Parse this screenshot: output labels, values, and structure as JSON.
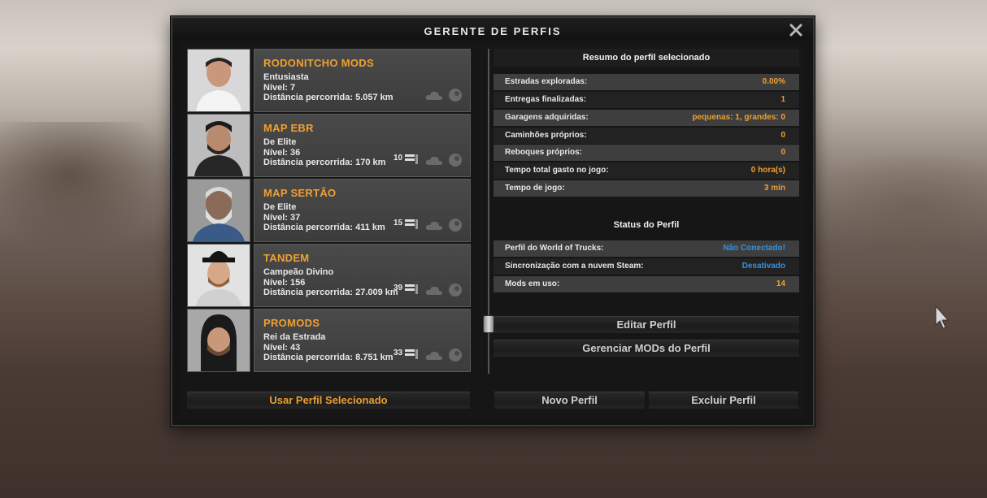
{
  "window": {
    "title": "GERENTE DE PERFIS"
  },
  "profiles": [
    {
      "name": "RODONITCHO MODS",
      "rank": "Entusiasta",
      "level": "Nível: 7",
      "distance": "Distância percorrida: 5.057 km",
      "mods": ""
    },
    {
      "name": "MAP EBR",
      "rank": "De Elite",
      "level": "Nível: 36",
      "distance": "Distância percorrida: 170 km",
      "mods": "10"
    },
    {
      "name": "MAP SERTÃO",
      "rank": "De Elite",
      "level": "Nível: 37",
      "distance": "Distância percorrida: 411 km",
      "mods": "15"
    },
    {
      "name": "TANDEM",
      "rank": "Campeão Divino",
      "level": "Nível: 156",
      "distance": "Distância percorrida: 27.009 km",
      "mods": "39"
    },
    {
      "name": "PROMODS",
      "rank": "Rei da Estrada",
      "level": "Nível: 43",
      "distance": "Distância percorrida: 8.751 km",
      "mods": "33"
    }
  ],
  "summary": {
    "header": "Resumo do perfil selecionado",
    "rows": [
      {
        "label": "Estradas exploradas:",
        "value": "0.00%"
      },
      {
        "label": "Entregas finalizadas:",
        "value": "1"
      },
      {
        "label": "Garagens adquiridas:",
        "value": "pequenas: 1, grandes: 0"
      },
      {
        "label": "Caminhões próprios:",
        "value": "0"
      },
      {
        "label": "Reboques próprios:",
        "value": "0"
      },
      {
        "label": "Tempo total gasto no jogo:",
        "value": "0 hora(s)"
      },
      {
        "label": "Tempo de jogo:",
        "value": "3 min"
      }
    ]
  },
  "status": {
    "header": "Status do Perfil",
    "rows": [
      {
        "label": "Perfil do World of Trucks:",
        "value": "Não Conectado!"
      },
      {
        "label": "Sincronização com a nuvem Steam:",
        "value": "Desativado"
      },
      {
        "label": "Mods em uso:",
        "value": "14"
      }
    ]
  },
  "buttons": {
    "edit": "Editar Perfil",
    "manage_mods": "Gerenciar MODs do Perfil",
    "use_selected": "Usar Perfil Selecionado",
    "new": "Novo Perfil",
    "delete": "Excluir Perfil"
  },
  "colors": {
    "accent": "#f0a030",
    "link_blue": "#3a90d8",
    "panel": "#141414"
  },
  "icons": [
    "close-icon",
    "mods-icon",
    "cloud-icon",
    "steam-icon",
    "cursor-icon"
  ]
}
